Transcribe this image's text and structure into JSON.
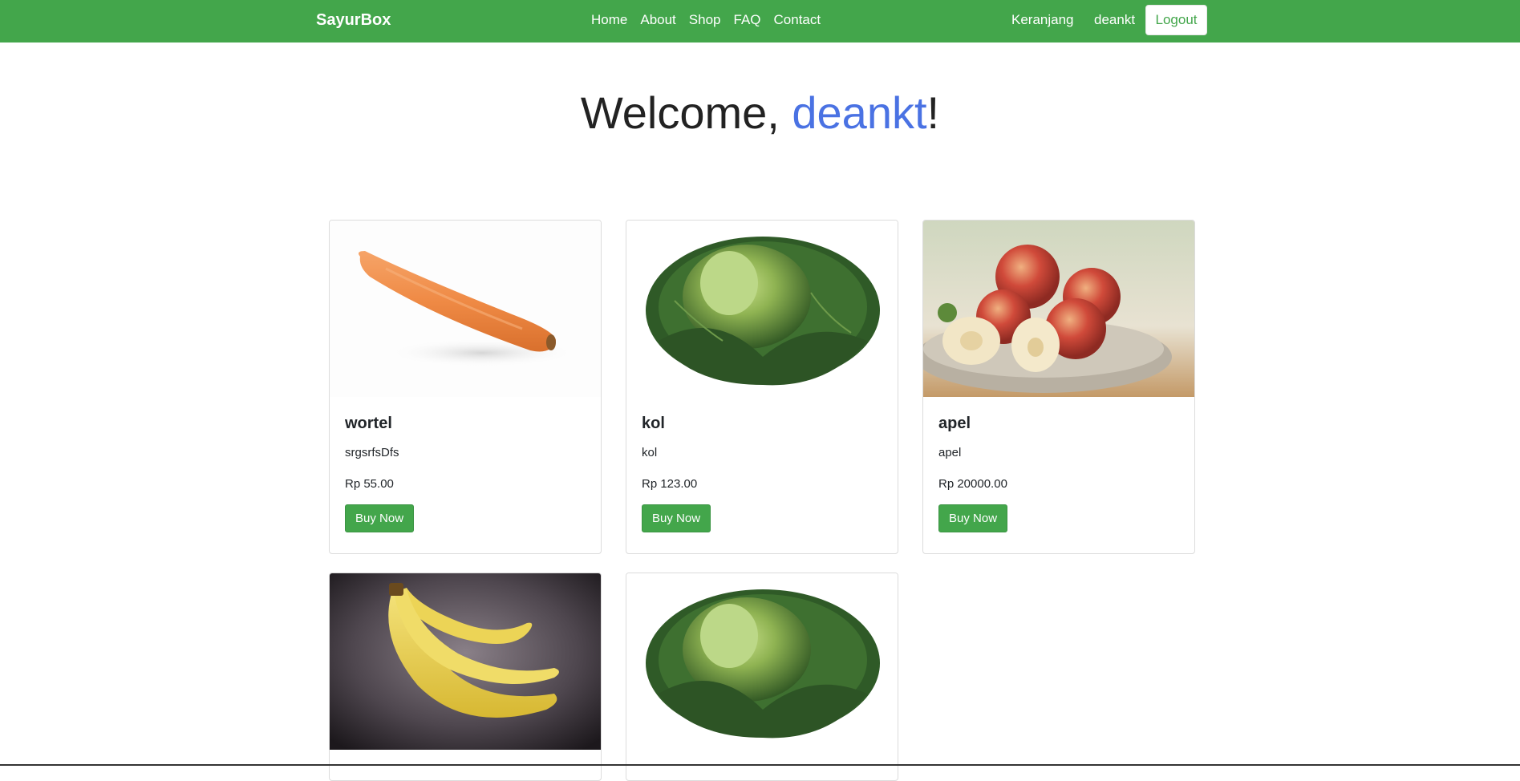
{
  "navbar": {
    "brand": "SayurBox",
    "links": [
      "Home",
      "About",
      "Shop",
      "FAQ",
      "Contact"
    ],
    "cart_label": "Keranjang",
    "username": "deankt",
    "logout_label": "Logout",
    "color": "#43a64b"
  },
  "hero": {
    "greeting": "Welcome, ",
    "username": "deankt",
    "suffix": "!",
    "accent_color": "#4a72e3"
  },
  "products": [
    {
      "name": "wortel",
      "description": "srgsrfsDfs",
      "price": "Rp 55.00",
      "button": "Buy Now",
      "image": "carrot"
    },
    {
      "name": "kol",
      "description": "kol",
      "price": "Rp 123.00",
      "button": "Buy Now",
      "image": "cabbage"
    },
    {
      "name": "apel",
      "description": "apel",
      "price": "Rp 20000.00",
      "button": "Buy Now",
      "image": "apples"
    },
    {
      "name": "",
      "description": "",
      "price": "",
      "button": "",
      "image": "bananas"
    },
    {
      "name": "",
      "description": "",
      "price": "",
      "button": "",
      "image": "cabbage"
    }
  ]
}
